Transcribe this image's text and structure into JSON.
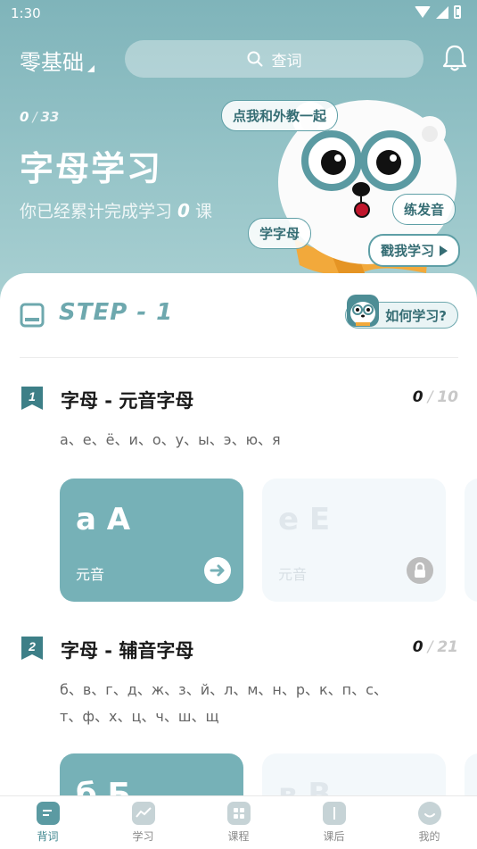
{
  "status_bar": {
    "time": "1:30"
  },
  "header": {
    "level_select": "零基础",
    "search_placeholder": "查词"
  },
  "hero": {
    "progress_done": "0",
    "progress_total": "33",
    "title": "字母学习",
    "summary_prefix": "你已经累计完成学习",
    "summary_count": "0",
    "summary_suffix": "课",
    "bubbles": {
      "teacher": "点我和外教一起",
      "pronounce": "练发音",
      "letters": "学字母",
      "cta": "戳我学习"
    }
  },
  "step": {
    "label": "STEP - 1",
    "howto": "如何学习?"
  },
  "lessons": [
    {
      "number": "1",
      "title": "字母 - 元音字母",
      "done": "0",
      "total": "10",
      "letters_line1": "а、е、ё、и、о、у、ы、э、ю、я",
      "letters_line2": "",
      "cards": [
        {
          "letter": "a A",
          "type": "元音",
          "state": "active"
        },
        {
          "letter": "e E",
          "type": "元音",
          "state": "locked"
        }
      ]
    },
    {
      "number": "2",
      "title": "字母 - 辅音字母",
      "done": "0",
      "total": "21",
      "letters_line1": "б、в、г、д、ж、з、й、л、м、н、р、к、п、с、",
      "letters_line2": "т、ф、х、ц、ч、ш、щ",
      "cards": [
        {
          "letter": "б Б",
          "type": "",
          "state": "active"
        },
        {
          "letter": "в В",
          "type": "",
          "state": "locked"
        }
      ]
    }
  ],
  "bottom_nav": [
    {
      "label": "背词",
      "icon": "word-card-icon",
      "active": true
    },
    {
      "label": "学习",
      "icon": "study-chart-icon",
      "active": false
    },
    {
      "label": "课程",
      "icon": "course-grid-icon",
      "active": false
    },
    {
      "label": "课后",
      "icon": "after-class-book-icon",
      "active": false
    },
    {
      "label": "我的",
      "icon": "profile-face-icon",
      "active": false
    }
  ],
  "colors": {
    "accent": "#76b1b7",
    "accent_dark": "#356d74",
    "hero_top": "#7fb4ba",
    "hero_bottom": "#a9d0d2"
  }
}
